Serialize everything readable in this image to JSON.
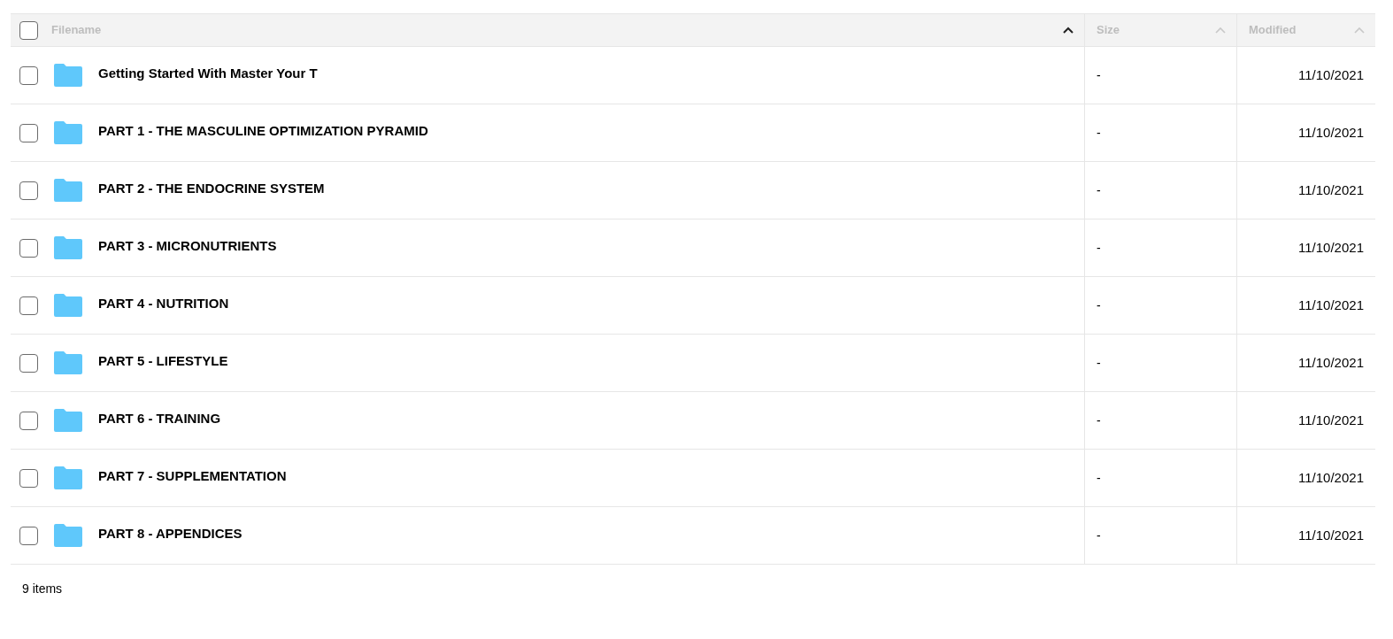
{
  "table": {
    "select_all": {
      "checked": false
    },
    "columns": [
      {
        "label": "Filename",
        "sorted": true
      },
      {
        "label": "Size",
        "sorted": false
      },
      {
        "label": "Modified",
        "sorted": false
      }
    ],
    "rows": [
      {
        "name": "Getting Started With Master Your T",
        "size": "-",
        "modified": "11/10/2021",
        "checked": false
      },
      {
        "name": "PART 1 - THE MASCULINE OPTIMIZATION PYRAMID",
        "size": "-",
        "modified": "11/10/2021",
        "checked": false
      },
      {
        "name": "PART 2 - THE ENDOCRINE SYSTEM",
        "size": "-",
        "modified": "11/10/2021",
        "checked": false
      },
      {
        "name": "PART 3 - MICRONUTRIENTS",
        "size": "-",
        "modified": "11/10/2021",
        "checked": false
      },
      {
        "name": "PART 4 - NUTRITION",
        "size": "-",
        "modified": "11/10/2021",
        "checked": false
      },
      {
        "name": "PART 5 - LIFESTYLE",
        "size": "-",
        "modified": "11/10/2021",
        "checked": false
      },
      {
        "name": "PART 6 - TRAINING",
        "size": "-",
        "modified": "11/10/2021",
        "checked": false
      },
      {
        "name": "PART 7 - SUPPLEMENTATION",
        "size": "-",
        "modified": "11/10/2021",
        "checked": false
      },
      {
        "name": "PART 8 - APPENDICES",
        "size": "-",
        "modified": "11/10/2021",
        "checked": false
      }
    ]
  },
  "status_bar": {
    "count": "9 items"
  }
}
